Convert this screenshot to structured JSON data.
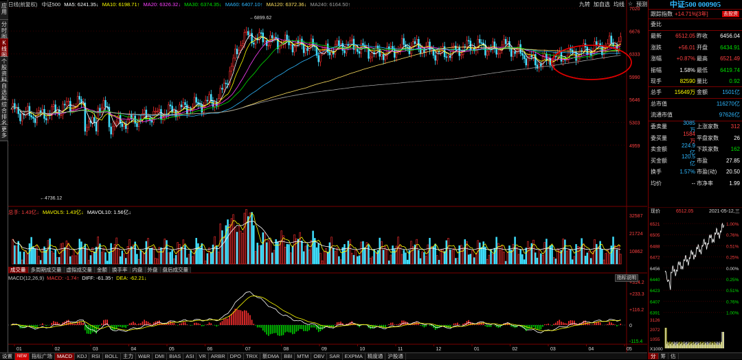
{
  "left_tabs": [
    {
      "label": "应用",
      "active": false
    },
    {
      "label": "分时图",
      "active": false
    },
    {
      "label": "K线图",
      "active": true
    },
    {
      "label": "个股资料",
      "active": false
    },
    {
      "label": "自选股",
      "active": false
    },
    {
      "label": "综合排名",
      "active": false
    },
    {
      "label": "更多",
      "active": false
    }
  ],
  "header": {
    "period": "日线(前复权)",
    "index_name": "中证500",
    "ma": [
      {
        "text": "MA5: 6241.35↓",
        "color": "#ffffff"
      },
      {
        "text": "MA10: 6198.71↑",
        "color": "#ffff00"
      },
      {
        "text": "MA20: 6326.32↓",
        "color": "#ff40ff"
      },
      {
        "text": "MA30: 6374.35↓",
        "color": "#00e000"
      },
      {
        "text": "MA60: 6407.10↑",
        "color": "#2fb8ff"
      },
      {
        "text": "MA120: 6372.36↓",
        "color": "#ffe060"
      },
      {
        "text": "MA240: 6164.50↑",
        "color": "#a0a0a0"
      }
    ],
    "tools": [
      "九转",
      "加自选",
      "均线",
      "☆",
      "预测"
    ]
  },
  "price_axis": {
    "labels": [
      "7020",
      "6676",
      "6333",
      "5990",
      "5646",
      "5303",
      "4959"
    ]
  },
  "annotations": {
    "high": "6899.62",
    "low": "4736.12"
  },
  "volume": {
    "header": [
      {
        "text": "总手: 1.43亿↓",
        "color": "#ff4040"
      },
      {
        "text": "MAVOL5: 1.43亿↓",
        "color": "#ffff00"
      },
      {
        "text": "MAVOL10: 1.56亿↓",
        "color": "#ffffff"
      }
    ],
    "axis": [
      "32587",
      "21724",
      "10862"
    ],
    "tabs": [
      {
        "label": "成交量",
        "sel": true
      },
      {
        "label": "多周期成交量",
        "sel": false
      },
      {
        "label": "虚拟成交量",
        "sel": false
      },
      {
        "label": "金额",
        "sel": false
      },
      {
        "label": "换手率",
        "sel": false
      },
      {
        "label": "内盘",
        "sel": false
      },
      {
        "label": "外盘",
        "sel": false
      },
      {
        "label": "盘后成交量",
        "sel": false
      }
    ]
  },
  "macd": {
    "header": [
      {
        "text": "MACD(12,26,9)",
        "color": "#c8c8c8"
      },
      {
        "text": "MACD: -1.74↑",
        "color": "#ff4040"
      },
      {
        "text": "DIFF: -61.35↑",
        "color": "#ffffff"
      },
      {
        "text": "DEA: -62.21↓",
        "color": "#ffff00"
      }
    ],
    "axis": [
      "+314.2",
      "+233.3",
      "+116.2",
      "0",
      "-115.4"
    ],
    "button": "指标说明"
  },
  "months": [
    "01",
    "02",
    "03",
    "04",
    "05",
    "06",
    "07",
    "08",
    "09",
    "10",
    "11",
    "12",
    "01",
    "02",
    "03",
    "04",
    "05"
  ],
  "indicator_tabs": [
    "设置",
    "NEW",
    "指标广场",
    "MACD",
    "KDJ",
    "RSI",
    "BOLL",
    "主力",
    "W&R",
    "DMI",
    "BIAS",
    "ASI",
    "VR",
    "ARBR",
    "DPO",
    "TRIX",
    "新DMA",
    "BBI",
    "MTM",
    "OBV",
    "SAR",
    "EXPMA",
    "精度通",
    "沪股通"
  ],
  "indicator_selected": "MACD",
  "right_panel": {
    "title": "中证500 000905",
    "track_label": "跟踪指数",
    "track_value": "+14.71%[3年]",
    "track_btn": "去投资",
    "rows": [
      {
        "l1": "委比",
        "v1": "",
        "l2": "",
        "v2": "",
        "c1": "white",
        "c2": "white",
        "sep": true
      },
      {
        "l1": "最新",
        "v1": "6512.05",
        "l2": "昨收",
        "v2": "6456.04",
        "c1": "red",
        "c2": "white"
      },
      {
        "l1": "涨跌",
        "v1": "+56.01",
        "l2": "开盘",
        "v2": "6434.91",
        "c1": "red",
        "c2": "green"
      },
      {
        "l1": "涨幅",
        "v1": "+0.87%",
        "l2": "最高",
        "v2": "6521.49",
        "c1": "red",
        "c2": "red"
      },
      {
        "l1": "振幅",
        "v1": "1.58%",
        "l2": "最低",
        "v2": "6419.74",
        "c1": "white",
        "c2": "green"
      },
      {
        "l1": "现手",
        "v1": "82590",
        "l2": "量比",
        "v2": "0.92",
        "c1": "yellow",
        "c2": "green",
        "sep": true
      },
      {
        "l1": "总手",
        "v1": "15649万",
        "l2": "金额",
        "v2": "1501亿",
        "c1": "yellow",
        "c2": "cyan",
        "sep": true
      },
      {
        "l1": "总市值",
        "v1": "",
        "l2": "",
        "v2": "116270亿",
        "c1": "white",
        "c2": "cyan"
      },
      {
        "l1": "流通市值",
        "v1": "",
        "l2": "",
        "v2": "97626亿",
        "c1": "white",
        "c2": "cyan",
        "sep": true
      },
      {
        "l1": "委卖量",
        "v1": "3085万",
        "l2": "上涨家数",
        "v2": "312",
        "c1": "cyan",
        "c2": "red"
      },
      {
        "l1": "委买量",
        "v1": "1584万",
        "l2": "平盘家数",
        "v2": "26",
        "c1": "red",
        "c2": "white"
      },
      {
        "l1": "卖金额",
        "v1": "224.9亿",
        "l2": "下跌家数",
        "v2": "162",
        "c1": "cyan",
        "c2": "green"
      },
      {
        "l1": "买金额",
        "v1": "120.5亿",
        "l2": "市盈",
        "v2": "27.85",
        "c1": "cyan",
        "c2": "white"
      },
      {
        "l1": "换手",
        "v1": "1.57%",
        "l2": "市盈(动)",
        "v2": "20.50",
        "c1": "cyan",
        "c2": "white"
      },
      {
        "l1": "均价",
        "v1": "--",
        "l2": "市净率",
        "v2": "1.99",
        "c1": "white",
        "c2": "white"
      }
    ],
    "mini": {
      "label_now": "现价",
      "price": "6512.05",
      "date": "2021-05-12,三",
      "left_axis": [
        "6521",
        "6505",
        "6488",
        "6472",
        "6456",
        "6440",
        "6423",
        "6407",
        "6391"
      ],
      "right_axis": [
        "1.00%",
        "0.76%",
        "0.51%",
        "0.25%",
        "0.00%",
        "0.25%",
        "0.51%",
        "0.76%",
        "1.00%"
      ],
      "vol_axis": [
        "3126",
        "2072",
        "1055",
        "X1000"
      ]
    },
    "bottom_tabs": [
      "分",
      "筹",
      "估"
    ]
  }
}
